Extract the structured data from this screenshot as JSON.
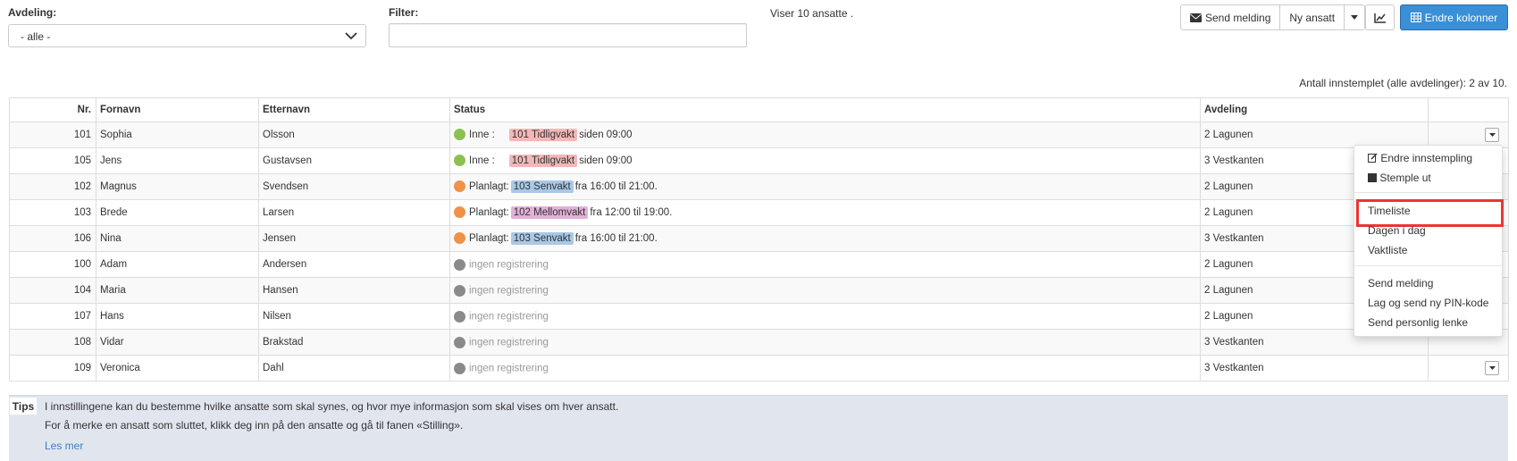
{
  "filters": {
    "avdeling_label": "Avdeling:",
    "avdeling_value": "- alle -",
    "filter_label": "Filter:",
    "filter_value": "",
    "count_text": "Viser 10 ansatte ."
  },
  "toolbar": {
    "send_message": "Send melding",
    "new_employee": "Ny ansatt",
    "change_columns": "Endre kolonner"
  },
  "summary": "Antall innstemplet (alle avdelinger): 2 av 10.",
  "table": {
    "headers": {
      "nr": "Nr.",
      "fornavn": "Fornavn",
      "etternavn": "Etternavn",
      "status": "Status",
      "avdeling": "Avdeling"
    },
    "rows": [
      {
        "nr": "101",
        "fornavn": "Sophia",
        "etternavn": "Olsson",
        "status_kind": "in",
        "status_label": "Inne :",
        "shift": "101 Tidligvakt",
        "shift_color": "#f2b8b8",
        "detail": "siden 09:00",
        "avdeling": "2 Lagunen"
      },
      {
        "nr": "105",
        "fornavn": "Jens",
        "etternavn": "Gustavsen",
        "status_kind": "in",
        "status_label": "Inne :",
        "shift": "101 Tidligvakt",
        "shift_color": "#f2b8b8",
        "detail": "siden 09:00",
        "avdeling": "3 Vestkanten"
      },
      {
        "nr": "102",
        "fornavn": "Magnus",
        "etternavn": "Svendsen",
        "status_kind": "planned",
        "status_label": "Planlagt:",
        "shift": "103 Senvakt",
        "shift_color": "#a9c8e6",
        "detail": "fra 16:00 til 21:00.",
        "avdeling": "2 Lagunen"
      },
      {
        "nr": "103",
        "fornavn": "Brede",
        "etternavn": "Larsen",
        "status_kind": "planned",
        "status_label": "Planlagt:",
        "shift": "102 Mellomvakt",
        "shift_color": "#e3b0d8",
        "detail": "fra 12:00 til 19:00.",
        "avdeling": "2 Lagunen"
      },
      {
        "nr": "106",
        "fornavn": "Nina",
        "etternavn": "Jensen",
        "status_kind": "planned",
        "status_label": "Planlagt:",
        "shift": "103 Senvakt",
        "shift_color": "#a9c8e6",
        "detail": "fra 16:00 til 21:00.",
        "avdeling": "3 Vestkanten"
      },
      {
        "nr": "100",
        "fornavn": "Adam",
        "etternavn": "Andersen",
        "status_kind": "none",
        "status_label": "ingen registrering",
        "shift": "",
        "shift_color": "",
        "detail": "",
        "avdeling": "2 Lagunen"
      },
      {
        "nr": "104",
        "fornavn": "Maria",
        "etternavn": "Hansen",
        "status_kind": "none",
        "status_label": "ingen registrering",
        "shift": "",
        "shift_color": "",
        "detail": "",
        "avdeling": "2 Lagunen"
      },
      {
        "nr": "107",
        "fornavn": "Hans",
        "etternavn": "Nilsen",
        "status_kind": "none",
        "status_label": "ingen registrering",
        "shift": "",
        "shift_color": "",
        "detail": "",
        "avdeling": "2 Lagunen"
      },
      {
        "nr": "108",
        "fornavn": "Vidar",
        "etternavn": "Brakstad",
        "status_kind": "none",
        "status_label": "ingen registrering",
        "shift": "",
        "shift_color": "",
        "detail": "",
        "avdeling": "3 Vestkanten"
      },
      {
        "nr": "109",
        "fornavn": "Veronica",
        "etternavn": "Dahl",
        "status_kind": "none",
        "status_label": "ingen registrering",
        "shift": "",
        "shift_color": "",
        "detail": "",
        "avdeling": "3 Vestkanten"
      }
    ]
  },
  "status_colors": {
    "in": "#8cc152",
    "planned": "#f0914a",
    "none": "#8a8a8a"
  },
  "context_menu": {
    "edit_clockin": "Endre innstempling",
    "clock_out": "Stemple ut",
    "timesheet": "Timeliste",
    "today": "Dagen i dag",
    "shift_list": "Vaktliste",
    "send_message": "Send melding",
    "send_pin": "Lag og send ny PIN-kode",
    "send_link": "Send personlig lenke"
  },
  "tips": {
    "tag": "Tips",
    "line1": "I innstillingene kan du bestemme hvilke ansatte som skal synes, og hvor mye informasjon som skal vises om hver ansatt.",
    "line2": "For å merke en ansatt som sluttet, klikk deg inn på den ansatte og gå til fanen «Stilling».",
    "read_more": "Les mer"
  }
}
